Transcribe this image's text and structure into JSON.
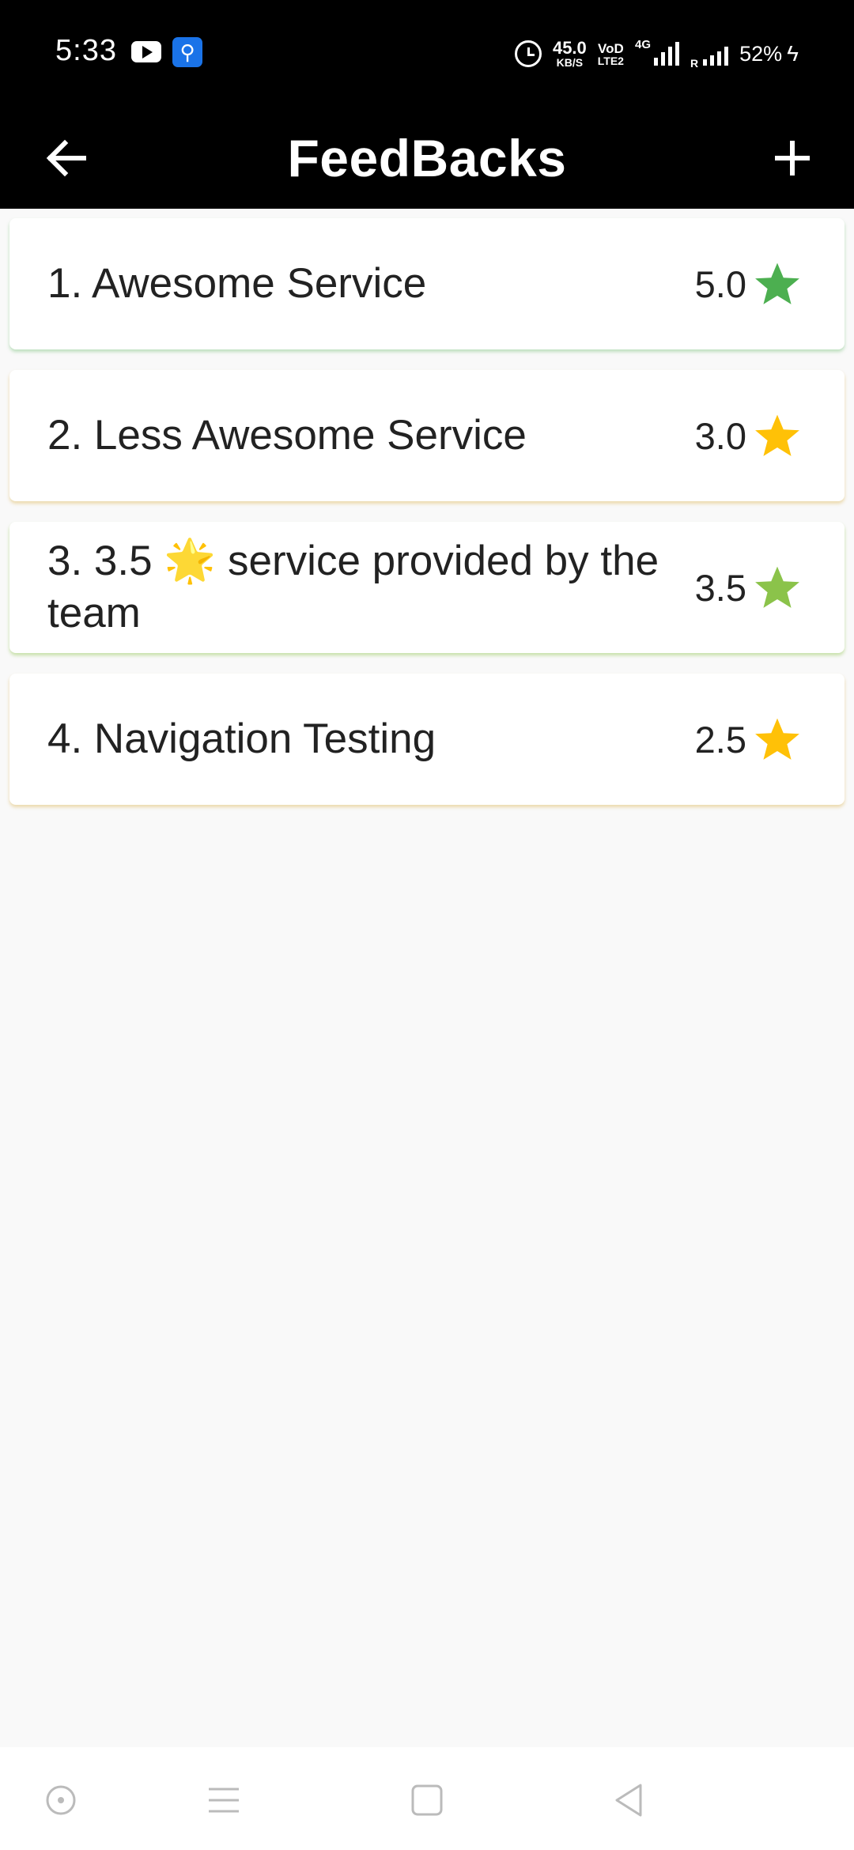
{
  "status_bar": {
    "time": "5:33",
    "speed_value": "45.0",
    "speed_unit": "KB/S",
    "volte_top": "VoD",
    "volte_bottom": "LTE2",
    "network": "4G",
    "roaming": "R",
    "battery": "52%"
  },
  "app_bar": {
    "title": "FeedBacks",
    "back_icon": "arrow-left-icon",
    "add_icon": "plus-icon"
  },
  "feedbacks": [
    {
      "title": "1. Awesome Service",
      "score": "5.0",
      "star_color": "#4caf50"
    },
    {
      "title": "2. Less Awesome Service",
      "score": "3.0",
      "star_color": "#ffc107"
    },
    {
      "title": "3. 3.5 🌟 service provided by the team",
      "score": "3.5",
      "star_color": "#8bc34a"
    },
    {
      "title": "4. Navigation Testing",
      "score": "2.5",
      "star_color": "#ffc107"
    }
  ],
  "nav_bar": {
    "icons": [
      "circle-dot-icon",
      "menu-icon",
      "square-icon",
      "back-triangle-icon"
    ]
  }
}
